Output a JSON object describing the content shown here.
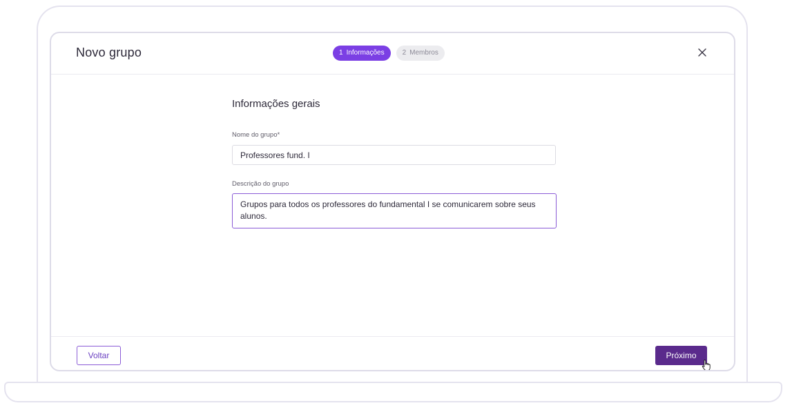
{
  "modal": {
    "title": "Novo grupo",
    "steps": [
      {
        "number": "1",
        "label": "Informações",
        "active": true
      },
      {
        "number": "2",
        "label": "Membros",
        "active": false
      }
    ],
    "close_icon": "close-icon"
  },
  "form": {
    "section_title": "Informações gerais",
    "name_label": "Nome do grupo*",
    "name_value": "Professores fund. I",
    "description_label": "Descrição do grupo",
    "description_value": "Grupos para todos os professores do fundamental I se comunicarem sobre seus alunos."
  },
  "footer": {
    "back_label": "Voltar",
    "next_label": "Próximo"
  },
  "colors": {
    "accent": "#7b3fe4",
    "primary_button": "#5a2a8c",
    "inactive_step": "#ececef"
  }
}
